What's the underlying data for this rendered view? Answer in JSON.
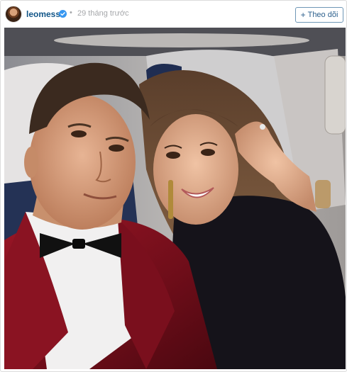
{
  "post": {
    "username": "leomessi",
    "separator": "•",
    "timestamp": "29 tháng trước",
    "follow_button": {
      "icon": "+",
      "label": "Theo dõi"
    }
  },
  "icons": {
    "avatar": "profile-avatar",
    "verified": "verified-badge-icon",
    "follow": "plus-icon"
  },
  "colors": {
    "username": "#125688",
    "verified": "#3897f0",
    "muted": "#a5a7aa",
    "follow_border": "#6f97b6"
  }
}
